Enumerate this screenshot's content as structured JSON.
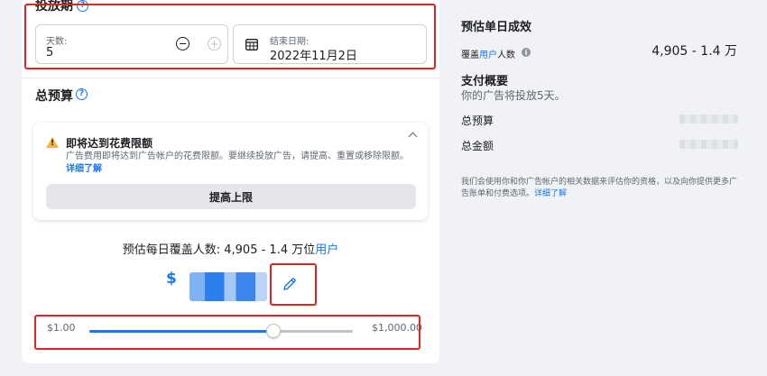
{
  "schedule": {
    "section_title": "投放期",
    "days_label": "天数:",
    "days_value": "5",
    "end_date_label": "结束日期:",
    "end_date_value": "2022年11月2日"
  },
  "budget": {
    "section_title": "总预算",
    "alert": {
      "title": "即将达到花费限额",
      "body": "广告费用即将达到广告帐户的花费限额。要继续投放广告，请提高、重置或移除限额。",
      "link": "详细了解",
      "button": "提高上限"
    },
    "estimate_prefix": "预估每日覆盖人数: 4,905 - 1.4 万位",
    "estimate_link": "用户",
    "currency_symbol": "$",
    "slider": {
      "min_label": "$1.00",
      "max_label": "$1,000.00",
      "position": 0.7
    }
  },
  "right": {
    "results_title": "预估单日成效",
    "reach_prefix": "覆盖",
    "reach_link": "用户",
    "reach_suffix": "人数",
    "reach_value": "4,905 - 1.4 万",
    "payment_title": "支付概要",
    "payment_sub": "你的广告将投放5天。",
    "total_budget_label": "总预算",
    "total_amount_label": "总金额",
    "footer_text": "我们会使用你和你广告帐户的相关数据来评估你的资格，以及向你提供更多广告账单和付费选项。",
    "footer_link": "详细了解"
  },
  "colors": {
    "accent": "#1877f2",
    "highlight": "#e02424",
    "warning": "#f7b928"
  }
}
